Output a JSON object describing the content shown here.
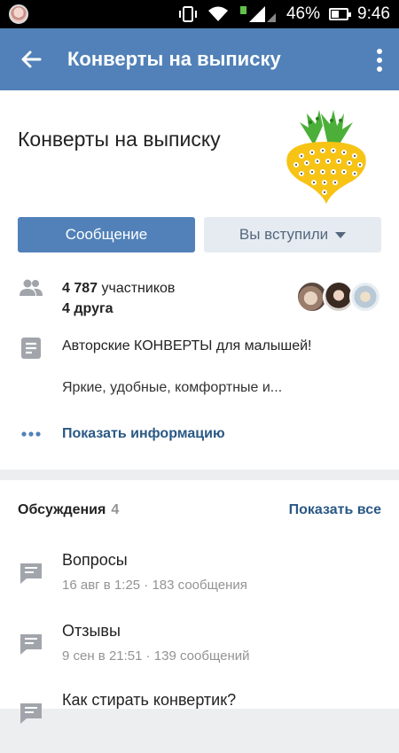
{
  "status_bar": {
    "battery": "46%",
    "time": "9:46",
    "icons": [
      "vibrate-icon",
      "wifi-icon",
      "signal-icon",
      "battery-icon"
    ]
  },
  "appbar": {
    "title": "Конверты на выписку",
    "back_icon": "arrow-left-icon",
    "menu_icon": "more-vertical-icon",
    "color": "#5181b8"
  },
  "group": {
    "name": "Конверты на выписку",
    "logo": "turnip-logo"
  },
  "actions": {
    "message_label": "Сообщение",
    "joined_label": "Вы вступили"
  },
  "members": {
    "count": "4 787",
    "count_suffix": " участников",
    "friends": "4 друга"
  },
  "description": {
    "line1": "Авторские КОНВЕРТЫ для малышей!",
    "line2": "Яркие, удобные, комфортные и..."
  },
  "show_info_label": "Показать информацию",
  "discussions": {
    "title": "Обсуждения",
    "count": "4",
    "show_all_label": "Показать все",
    "topics": [
      {
        "title": "Вопросы",
        "meta": "16 авг в 1:25 · 183 сообщения"
      },
      {
        "title": "Отзывы",
        "meta": "9 сен в 21:51 · 139 сообщений"
      },
      {
        "title": "Как стирать конвертик?",
        "meta": ""
      }
    ]
  },
  "colors": {
    "link": "#2a5885",
    "accent": "#5181b8",
    "muted": "#939393"
  }
}
